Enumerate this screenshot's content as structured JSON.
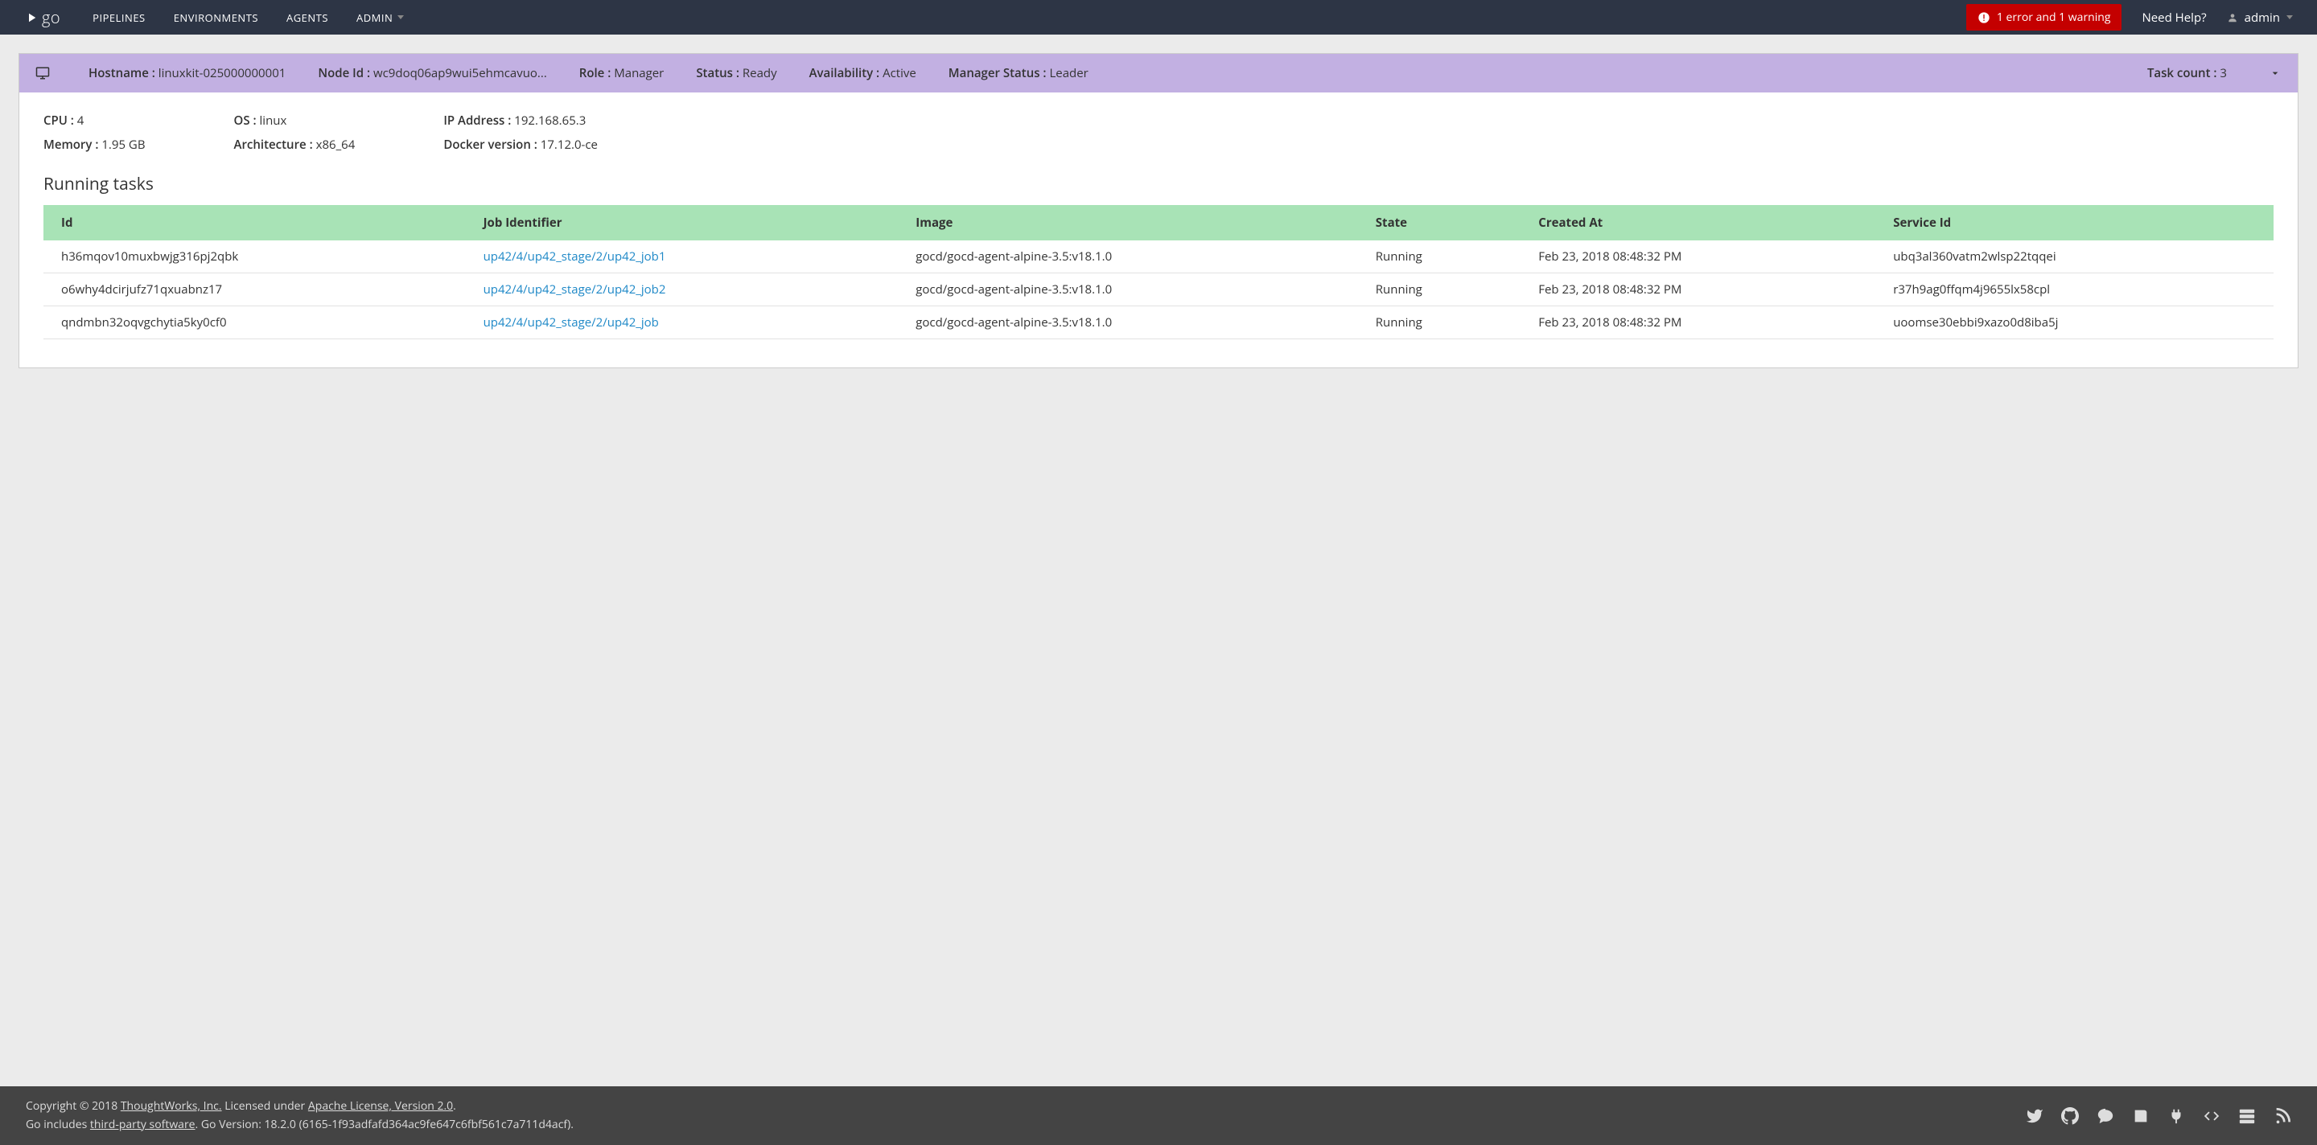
{
  "nav": {
    "links": [
      "PIPELINES",
      "ENVIRONMENTS",
      "AGENTS",
      "ADMIN"
    ],
    "error_badge": "1 error and 1 warning",
    "help": "Need Help?",
    "user": "admin"
  },
  "header": {
    "hostname_label": "Hostname",
    "hostname": "linuxkit-025000000001",
    "nodeid_label": "Node Id",
    "nodeid": "wc9doq06ap9wui5ehmcavuo...",
    "role_label": "Role",
    "role": "Manager",
    "status_label": "Status",
    "status": "Ready",
    "availability_label": "Availability",
    "availability": "Active",
    "manager_status_label": "Manager Status",
    "manager_status": "Leader",
    "task_count_label": "Task count",
    "task_count": "3"
  },
  "details": {
    "cpu_label": "CPU",
    "cpu": "4",
    "memory_label": "Memory",
    "memory": "1.95 GB",
    "os_label": "OS",
    "os": "linux",
    "arch_label": "Architecture",
    "arch": "x86_64",
    "ip_label": "IP Address",
    "ip": "192.168.65.3",
    "docker_label": "Docker version",
    "docker": "17.12.0-ce"
  },
  "tasks": {
    "title": "Running tasks",
    "columns": [
      "Id",
      "Job Identifier",
      "Image",
      "State",
      "Created At",
      "Service Id"
    ],
    "rows": [
      {
        "id": "h36mqov10muxbwjg316pj2qbk",
        "job": "up42/4/up42_stage/2/up42_job1",
        "image": "gocd/gocd-agent-alpine-3.5:v18.1.0",
        "state": "Running",
        "created": "Feb 23, 2018 08:48:32 PM",
        "service": "ubq3al360vatm2wlsp22tqqei"
      },
      {
        "id": "o6why4dcirjufz71qxuabnz17",
        "job": "up42/4/up42_stage/2/up42_job2",
        "image": "gocd/gocd-agent-alpine-3.5:v18.1.0",
        "state": "Running",
        "created": "Feb 23, 2018 08:48:32 PM",
        "service": "r37h9ag0ffqm4j9655lx58cpl"
      },
      {
        "id": "qndmbn32oqvgchytia5ky0cf0",
        "job": "up42/4/up42_stage/2/up42_job",
        "image": "gocd/gocd-agent-alpine-3.5:v18.1.0",
        "state": "Running",
        "created": "Feb 23, 2018 08:48:32 PM",
        "service": "uoomse30ebbi9xazo0d8iba5j"
      }
    ]
  },
  "footer": {
    "copyright_prefix": "Copyright © 2018 ",
    "company": "ThoughtWorks, Inc.",
    "license_prefix": " Licensed under ",
    "license": "Apache License, Version 2.0",
    "license_suffix": ".",
    "line2_prefix": "Go includes ",
    "thirdparty": "third-party software",
    "version_suffix": ". Go Version: 18.2.0 (6165-1f93adfafd364ac9fe647c6fbf561c7a711d4acf)."
  }
}
